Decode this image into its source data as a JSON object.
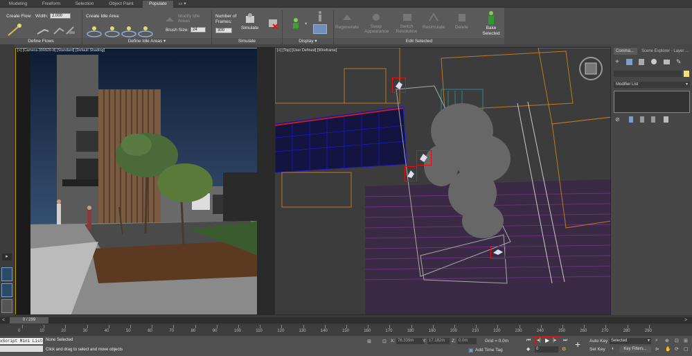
{
  "tabs": [
    {
      "label": "Modeling",
      "active": false
    },
    {
      "label": "Freeform",
      "active": false
    },
    {
      "label": "Selection",
      "active": false
    },
    {
      "label": "Object Paint",
      "active": false
    },
    {
      "label": "Populate",
      "active": true
    },
    {
      "label": "▭ ▾",
      "active": false
    }
  ],
  "ribbon": {
    "create_flow_label": "Create Flow:",
    "width_label": "Width:",
    "width_value": "2.000",
    "create_idle_label": "Create Idle Area:",
    "modify_idle_label": "Modify Idle Areas",
    "brush_size_label": "Brush Size:",
    "brush_size_value": "24",
    "frames_label": "Number of Frames:",
    "frames_value": "300",
    "simulate_label": "Simulate",
    "regenerate_label": "Regenerate",
    "swap_label": "Swap Appearance",
    "switch_label": "Switch Resolution",
    "resimulate_label": "Resimulate",
    "delete_label": "Delete",
    "bake_label": "Bake Selected",
    "groups": {
      "define_flows": "Define Flows",
      "define_idle": "Define Idle Areas ▾",
      "simulate": "Simulate",
      "display": "Display ▾",
      "edit_selected": "Edit Selected"
    }
  },
  "viewports": {
    "left_label": "[+] [Camera-300920-8] [Standard] [Default Shading]",
    "right_label": "[+] [Top] [User Defined] [Wireframe]"
  },
  "command_panel": {
    "tab_active": "Comma...",
    "tab_other": "Scene Explorer - Layer ...",
    "modifier_list": "Modifier List"
  },
  "timeline": {
    "frame_display": "0 / 299",
    "ticks": [
      "0",
      "10",
      "20",
      "30",
      "40",
      "50",
      "60",
      "70",
      "80",
      "90",
      "100",
      "110",
      "120",
      "130",
      "140",
      "150",
      "160",
      "170",
      "180",
      "190",
      "200",
      "210",
      "220",
      "230",
      "240",
      "250",
      "260",
      "270",
      "280",
      "290"
    ]
  },
  "status": {
    "maxscript": "xScript Mini Liste",
    "selection": "None Selected",
    "prompt": "Click and drag to select and move objects",
    "x_label": "X:",
    "x_value": "76.339m",
    "y_label": "Y:",
    "y_value": "17.182m",
    "z_label": "Z:",
    "z_value": "0.0m",
    "grid": "Grid = 0.0m",
    "add_time_tag": "Add Time Tag",
    "auto_key": "Auto Key",
    "set_key": "Set Key",
    "selected_value": "Selected",
    "key_filters": "Key Filters...",
    "frame_value": "0"
  },
  "colors": {
    "accent_red": "#e01010",
    "viewport_border": "#c9a400",
    "wire_purple": "#7a3a8a",
    "wire_blue": "#1a1ad0"
  }
}
